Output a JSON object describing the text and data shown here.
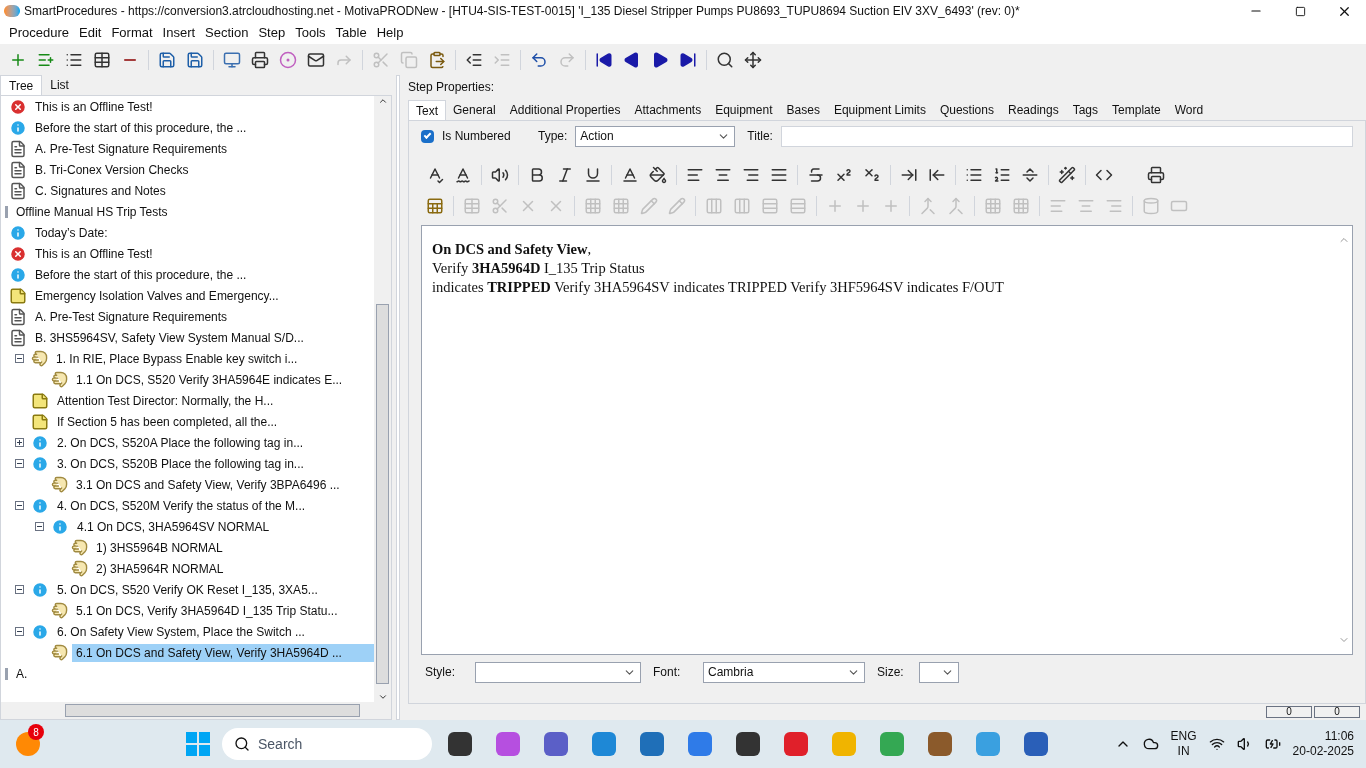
{
  "window": {
    "title": "SmartProcedures - https://conversion3.atrcloudhosting.net - MotivaPRODNew - [HTU4-SIS-TEST-0015] 'I_135 Diesel Stripper Pumps PU8693_TUPU8694 Suction EIV 3XV_6493' (rev: 0)*"
  },
  "menu": [
    "Procedure",
    "Edit",
    "Format",
    "Insert",
    "Section",
    "Step",
    "Tools",
    "Table",
    "Help"
  ],
  "toolbar": [
    {
      "kind": "add",
      "disabled": false
    },
    {
      "kind": "add-child",
      "disabled": false
    },
    {
      "kind": "list",
      "disabled": false
    },
    {
      "kind": "table",
      "disabled": false
    },
    {
      "kind": "remove",
      "disabled": false
    },
    {
      "kind": "sep"
    },
    {
      "kind": "save-all",
      "disabled": false
    },
    {
      "kind": "save",
      "disabled": false
    },
    {
      "kind": "sep"
    },
    {
      "kind": "monitor",
      "disabled": false
    },
    {
      "kind": "print",
      "disabled": false
    },
    {
      "kind": "ring",
      "disabled": false
    },
    {
      "kind": "mail",
      "disabled": false
    },
    {
      "kind": "forward",
      "disabled": true
    },
    {
      "kind": "sep"
    },
    {
      "kind": "cut",
      "disabled": true
    },
    {
      "kind": "copy",
      "disabled": true
    },
    {
      "kind": "paste",
      "disabled": false
    },
    {
      "kind": "sep"
    },
    {
      "kind": "outdent",
      "disabled": false
    },
    {
      "kind": "indent",
      "disabled": true
    },
    {
      "kind": "sep"
    },
    {
      "kind": "undo",
      "disabled": false
    },
    {
      "kind": "redo",
      "disabled": true
    },
    {
      "kind": "sep"
    },
    {
      "kind": "first",
      "disabled": false
    },
    {
      "kind": "prev",
      "disabled": false
    },
    {
      "kind": "next",
      "disabled": false
    },
    {
      "kind": "last",
      "disabled": false
    },
    {
      "kind": "sep"
    },
    {
      "kind": "find",
      "disabled": false
    },
    {
      "kind": "move",
      "disabled": false
    }
  ],
  "left_tabs": [
    {
      "label": "Tree",
      "selected": true
    },
    {
      "label": "List",
      "selected": false
    }
  ],
  "tree": [
    {
      "kind": "error",
      "label": "This is an Offline Test!",
      "selected": false
    },
    {
      "kind": "info",
      "label": "Before the start of this procedure, the ...",
      "selected": false
    },
    {
      "kind": "doc",
      "label": "A. Pre-Test Signature Requirements",
      "selected": false
    },
    {
      "kind": "doc",
      "label": "B. Tri-Conex Version Checks",
      "selected": false
    },
    {
      "kind": "doc",
      "label": "C. Signatures and Notes",
      "selected": false
    },
    {
      "kind": "section",
      "label": "Offline Manual HS Trip Tests",
      "selected": false
    },
    {
      "kind": "info",
      "label": "Today’s Date:",
      "selected": false
    },
    {
      "kind": "error",
      "label": "This is an Offline Test!",
      "selected": false
    },
    {
      "kind": "info",
      "label": "Before the start of this procedure, the ...",
      "selected": false
    },
    {
      "kind": "note",
      "label": "Emergency Isolation Valves and Emergency...",
      "selected": false
    },
    {
      "kind": "doc",
      "label": "A. Pre-Test Signature Requirements",
      "selected": false
    },
    {
      "kind": "doc",
      "label": "B. 3HS5964SV, Safety View System Manual S/D...",
      "selected": false,
      "children": [
        {
          "kind": "hand",
          "label": "1. In RIE, Place Bypass Enable key switch i...",
          "selected": false,
          "expanded": true,
          "children": [
            {
              "kind": "hand",
              "label": "1.1 On DCS, S520 Verify 3HA5964E indicates E...",
              "selected": false
            }
          ]
        },
        {
          "kind": "note",
          "label": "Attention Test Director: Normally, the H...",
          "selected": false
        },
        {
          "kind": "note",
          "label": "If Section 5 has been completed, all the...",
          "selected": false
        },
        {
          "kind": "info",
          "label": "2. On DCS, S520A Place the following tag in...",
          "selected": false,
          "expanded": false
        },
        {
          "kind": "info",
          "label": "3. On DCS, S520B Place the following tag in...",
          "selected": false,
          "expanded": true,
          "children": [
            {
              "kind": "hand",
              "label": "3.1 On DCS and Safety View, Verify 3BPA6496 ...",
              "selected": false
            }
          ]
        },
        {
          "kind": "info",
          "label": "4. On DCS, S520M Verify the status of the M...",
          "selected": false,
          "expanded": true,
          "children": [
            {
              "kind": "info",
              "label": "4.1 On DCS, 3HA5964SV NORMAL",
              "selected": false,
              "expanded": true,
              "children": [
                {
                  "kind": "hand",
                  "label": "1) 3HS5964B NORMAL",
                  "selected": false
                },
                {
                  "kind": "hand",
                  "label": "2) 3HA5964R NORMAL",
                  "selected": false
                }
              ]
            }
          ]
        },
        {
          "kind": "info",
          "label": "5. On DCS, S520 Verify OK Reset I_135, 3XA5...",
          "selected": false,
          "expanded": true,
          "children": [
            {
              "kind": "hand",
              "label": "5.1 On DCS, Verify 3HA5964D I_135 Trip Statu...",
              "selected": false
            }
          ]
        },
        {
          "kind": "info",
          "label": "6. On Safety View System, Place the Switch ...",
          "selected": false,
          "expanded": true,
          "children": [
            {
              "kind": "hand",
              "label": "6.1 On DCS and Safety View, Verify 3HA5964D ...",
              "selected": true
            }
          ]
        }
      ]
    },
    {
      "kind": "section",
      "label": "A.",
      "selected": false
    }
  ],
  "step_properties": {
    "heading": "Step Properties:",
    "tabs": [
      {
        "label": "Text",
        "selected": true
      },
      {
        "label": "General",
        "selected": false
      },
      {
        "label": "Additional Properties",
        "selected": false
      },
      {
        "label": "Attachments",
        "selected": false
      },
      {
        "label": "Equipment",
        "selected": false
      },
      {
        "label": "Bases",
        "selected": false
      },
      {
        "label": "Equipment Limits",
        "selected": false
      },
      {
        "label": "Questions",
        "selected": false
      },
      {
        "label": "Readings",
        "selected": false
      },
      {
        "label": "Tags",
        "selected": false
      },
      {
        "label": "Template",
        "selected": false
      },
      {
        "label": "Word",
        "selected": false
      }
    ],
    "is_numbered": {
      "label": "Is Numbered",
      "checked": true
    },
    "type": {
      "label": "Type:",
      "value": "Action"
    },
    "title": {
      "label": "Title:"
    },
    "format_row_1": [
      {
        "kind": "spell",
        "disabled": false
      },
      {
        "kind": "spell-auto",
        "disabled": false
      },
      {
        "kind": "sep"
      },
      {
        "kind": "speaker",
        "disabled": false
      },
      {
        "kind": "sep"
      },
      {
        "kind": "bold",
        "disabled": false
      },
      {
        "kind": "italic",
        "disabled": false
      },
      {
        "kind": "underline",
        "disabled": false
      },
      {
        "kind": "sep"
      },
      {
        "kind": "font-color",
        "disabled": false
      },
      {
        "kind": "fill",
        "disabled": false
      },
      {
        "kind": "sep"
      },
      {
        "kind": "align-left",
        "disabled": false
      },
      {
        "kind": "align-center",
        "disabled": false
      },
      {
        "kind": "align-right",
        "disabled": false
      },
      {
        "kind": "justify",
        "disabled": false
      },
      {
        "kind": "sep"
      },
      {
        "kind": "strike",
        "disabled": false
      },
      {
        "kind": "superscript",
        "disabled": false
      },
      {
        "kind": "subscript",
        "disabled": false
      },
      {
        "kind": "sep"
      },
      {
        "kind": "indent",
        "disabled": false
      },
      {
        "kind": "outdent",
        "disabled": false
      },
      {
        "kind": "sep"
      },
      {
        "kind": "bullets",
        "disabled": false
      },
      {
        "kind": "numbers",
        "disabled": false
      },
      {
        "kind": "rule",
        "disabled": false
      },
      {
        "kind": "sep"
      },
      {
        "kind": "wand",
        "disabled": false
      },
      {
        "kind": "sep"
      },
      {
        "kind": "code",
        "disabled": false
      },
      {
        "kind": "gap"
      },
      {
        "kind": "print",
        "disabled": false
      }
    ],
    "format_row_2": [
      {
        "kind": "table-insert",
        "disabled": false
      },
      {
        "kind": "sep"
      },
      {
        "kind": "table",
        "disabled": true
      },
      {
        "kind": "cut",
        "disabled": true
      },
      {
        "kind": "close",
        "disabled": true
      },
      {
        "kind": "close",
        "disabled": true
      },
      {
        "kind": "sep"
      },
      {
        "kind": "grid",
        "disabled": true
      },
      {
        "kind": "grid",
        "disabled": true
      },
      {
        "kind": "edit",
        "disabled": true
      },
      {
        "kind": "edit",
        "disabled": true
      },
      {
        "kind": "sep"
      },
      {
        "kind": "columns",
        "disabled": true
      },
      {
        "kind": "columns",
        "disabled": true
      },
      {
        "kind": "rows",
        "disabled": true
      },
      {
        "kind": "rows",
        "disabled": true
      },
      {
        "kind": "sep"
      },
      {
        "kind": "add",
        "disabled": true
      },
      {
        "kind": "add",
        "disabled": true
      },
      {
        "kind": "add",
        "disabled": true
      },
      {
        "kind": "sep"
      },
      {
        "kind": "merge",
        "disabled": true
      },
      {
        "kind": "merge",
        "disabled": true
      },
      {
        "kind": "sep"
      },
      {
        "kind": "grid",
        "disabled": true
      },
      {
        "kind": "grid",
        "disabled": true
      },
      {
        "kind": "sep"
      },
      {
        "kind": "align-left",
        "disabled": true
      },
      {
        "kind": "align-center",
        "disabled": true
      },
      {
        "kind": "align-right",
        "disabled": true
      },
      {
        "kind": "sep"
      },
      {
        "kind": "cylinder",
        "disabled": true
      },
      {
        "kind": "slot",
        "disabled": true
      }
    ],
    "editor_lines": [
      "**On DCS and Safety View**,",
      "Verify **3HA5964D** I_135 Trip Status",
      "indicates **TRIPPED** Verify 3HA5964SV indicates TRIPPED Verify 3HF5964SV indicates F/OUT"
    ],
    "style": {
      "label": "Style:"
    },
    "font": {
      "label": "Font:",
      "value": "Cambria"
    },
    "size": {
      "label": "Size:"
    }
  },
  "status_bar": [
    "0",
    "0"
  ],
  "taskbar": {
    "notification_count": "8",
    "search": {
      "placeholder": "Search"
    },
    "language": "ENG",
    "region": "IN",
    "time": "11:06",
    "date": "20-02-2025"
  }
}
